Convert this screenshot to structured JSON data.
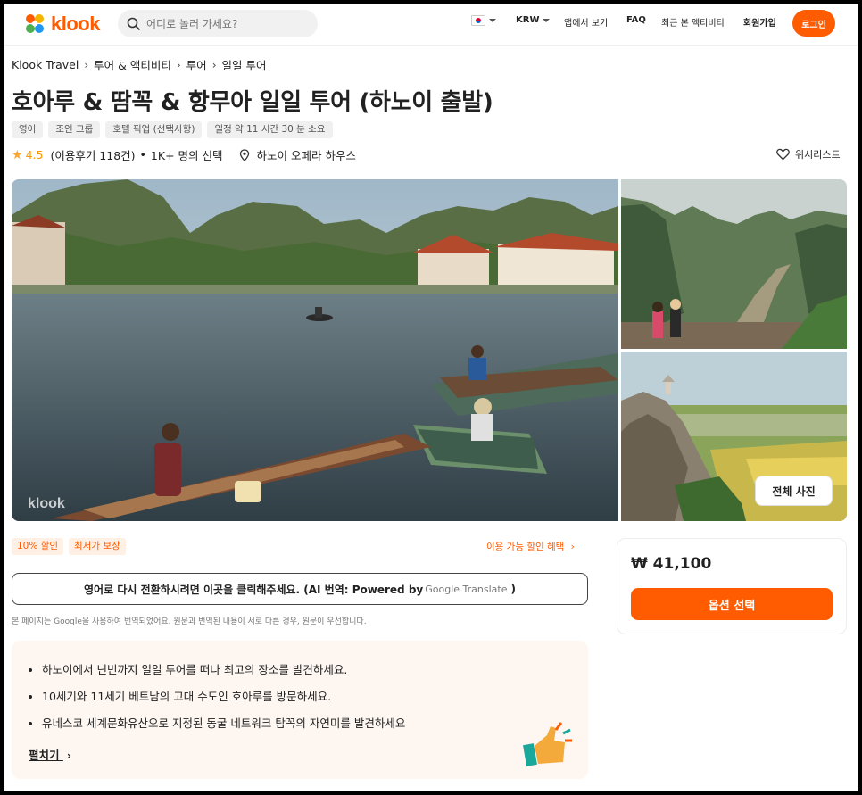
{
  "header": {
    "logo_text": "klook",
    "search_placeholder": "어디로 놀러 가세요?",
    "currency": "KRW",
    "nav_items": [
      "앱에서 보기",
      "FAQ",
      "최근 본 액티비티",
      "회원가입"
    ],
    "login_label": "로그인"
  },
  "breadcrumb": [
    "Klook Travel",
    "투어 & 액티비티",
    "투어",
    "일일 투어"
  ],
  "activity": {
    "title": "호아루 & 땀꼭 & 항무아 일일 투어 (하노이 출발)",
    "tags": [
      "영어",
      "조인 그룹",
      "호텔 픽업 (선택사항)",
      "일정 약 11 시간 30 분 소요"
    ],
    "rating": "4.5",
    "reviews": "(이용후기 118건)",
    "booked": "1K+ 명의 선택",
    "location": "하노이 오페라 하우스",
    "wishlist": "위시리스트"
  },
  "gallery": {
    "watermark": "klook",
    "all_photos_label": "전체 사진"
  },
  "promo": {
    "badges": [
      "10% 할인",
      "최저가 보장"
    ],
    "discount_link": "이용 가능 할인 혜택"
  },
  "translate": {
    "button_main": "영어로 다시 전환하시려면 이곳을 클릭해주세요. (AI 번역: Powered by",
    "button_google": "Google Translate",
    "button_end": ")",
    "note": "본 페이지는 Google을 사용하여 번역되었어요. 원문과 번역된 내용이 서로 다른 경우, 원문이 우선합니다."
  },
  "highlights": {
    "items": [
      "하노이에서 닌빈까지 일일 투어를 떠나 최고의 장소를 발견하세요.",
      "10세기와 11세기 베트남의 고대 수도인 호아루를 방문하세요.",
      "유네스코 세계문화유산으로 지정된 동굴 네트워크 탐꼭의 자연미를 발견하세요"
    ],
    "expand_label": "펼치기"
  },
  "booking": {
    "price": "₩ 41,100",
    "option_label": "옵션 선택"
  },
  "colors": {
    "brand": "#ff5b00",
    "star": "#ffa628"
  }
}
